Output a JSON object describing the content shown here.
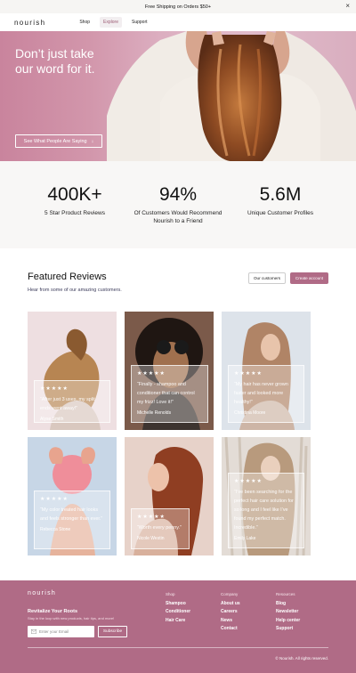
{
  "banner": {
    "text": "Free Shipping on Orders $50+",
    "close_icon": "×"
  },
  "nav": {
    "logo": "nourish",
    "links": [
      "Shop",
      "Explore",
      "Support"
    ],
    "active": "Explore"
  },
  "hero": {
    "title": "Don’t just take our word for it.",
    "cta": "See What People Are Saying",
    "cta_icon": "↓"
  },
  "stats": [
    {
      "value": "400K+",
      "label": "5 Star Product Reviews"
    },
    {
      "value": "94%",
      "label": "Of Customers Would Recommend Nourish to a Friend"
    },
    {
      "value": "5.6M",
      "label": "Unique Customer Profiles"
    }
  ],
  "featured": {
    "title": "Featured Reviews",
    "subtitle": "Hear from some of our amazing customers.",
    "btn_customers": "Our customers",
    "btn_create": "Create account"
  },
  "reviews": [
    {
      "stars": "★★★★★",
      "quote": "“After just 3 uses, my split ends went away!”",
      "author": "Alyse Smith"
    },
    {
      "stars": "★★★★★",
      "quote": "“Finally - shampoo and conditioner that can control my frizz! Love it!”",
      "author": "Michelle Renolds"
    },
    {
      "stars": "★★★★★",
      "quote": "“My hair has never grown faster and looked more healthy!”",
      "author": "Christina Moore"
    },
    {
      "stars": "★★★★★",
      "quote": "“My color treated hair looks and feels stronger than ever.”",
      "author": "Rebecca Stone"
    },
    {
      "stars": "★★★★★",
      "quote": "“Worth every penny.”",
      "author": "Nicole Westin"
    },
    {
      "stars": "★★★★★",
      "quote": "“I’ve been searching for the perfect hair care solution for so long and I feel like I’ve found my perfect match. Incredible.”",
      "author": "Emily Lake"
    }
  ],
  "footer": {
    "logo": "nourish",
    "heading": "Revitalize Your Roots",
    "subtext": "Stay in the loop with new products, hair tips, and more!",
    "email_placeholder": "Enter your Email",
    "subscribe": "Subscribe",
    "columns": [
      {
        "title": "Shop",
        "links": [
          "Shampoo",
          "Conditioner",
          "Hair Care"
        ]
      },
      {
        "title": "Company",
        "links": [
          "About us",
          "Careers",
          "News",
          "Contact"
        ]
      },
      {
        "title": "Resources",
        "links": [
          "Blog",
          "Newsletter",
          "Help center",
          "Support"
        ]
      }
    ],
    "copyright": "© Nourish. All rights reserved."
  },
  "colors": {
    "brand": "#b06b86",
    "hero_bg": "#d296ab",
    "stats_bg": "#f8f7f6"
  }
}
